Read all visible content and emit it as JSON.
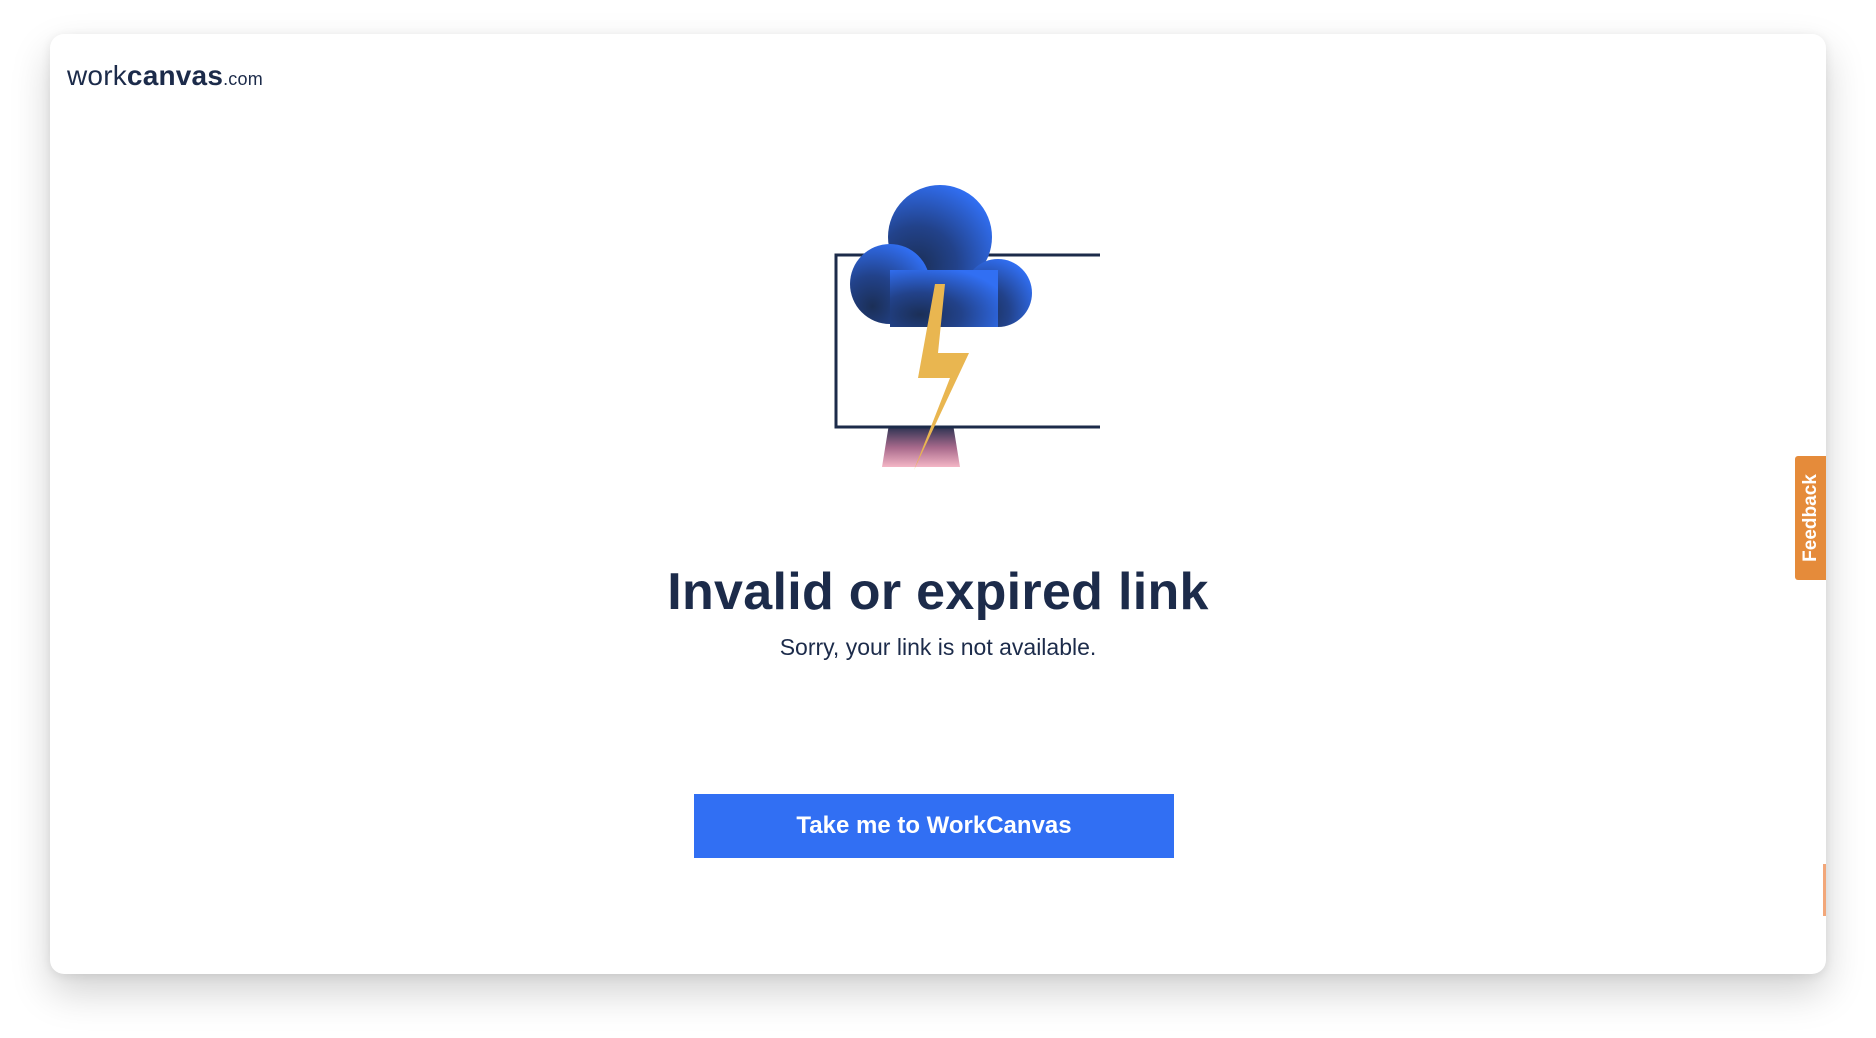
{
  "brand": {
    "logo_part1": "work",
    "logo_part2": "canvas",
    "logo_part3": ".com"
  },
  "main": {
    "headline": "Invalid or expired link",
    "subtext": "Sorry, your link is not available.",
    "cta_label": "Take me to WorkCanvas"
  },
  "feedback": {
    "label": "Feedback"
  },
  "illustration": {
    "icons": [
      "monitor-icon",
      "cloud-icon",
      "lightning-bolt-icon"
    ]
  },
  "colors": {
    "primary": "#316ff3",
    "text": "#1c2b4a",
    "feedback": "#e58b3a",
    "bolt": "#e9b650",
    "pink": "#f4b6c6"
  }
}
